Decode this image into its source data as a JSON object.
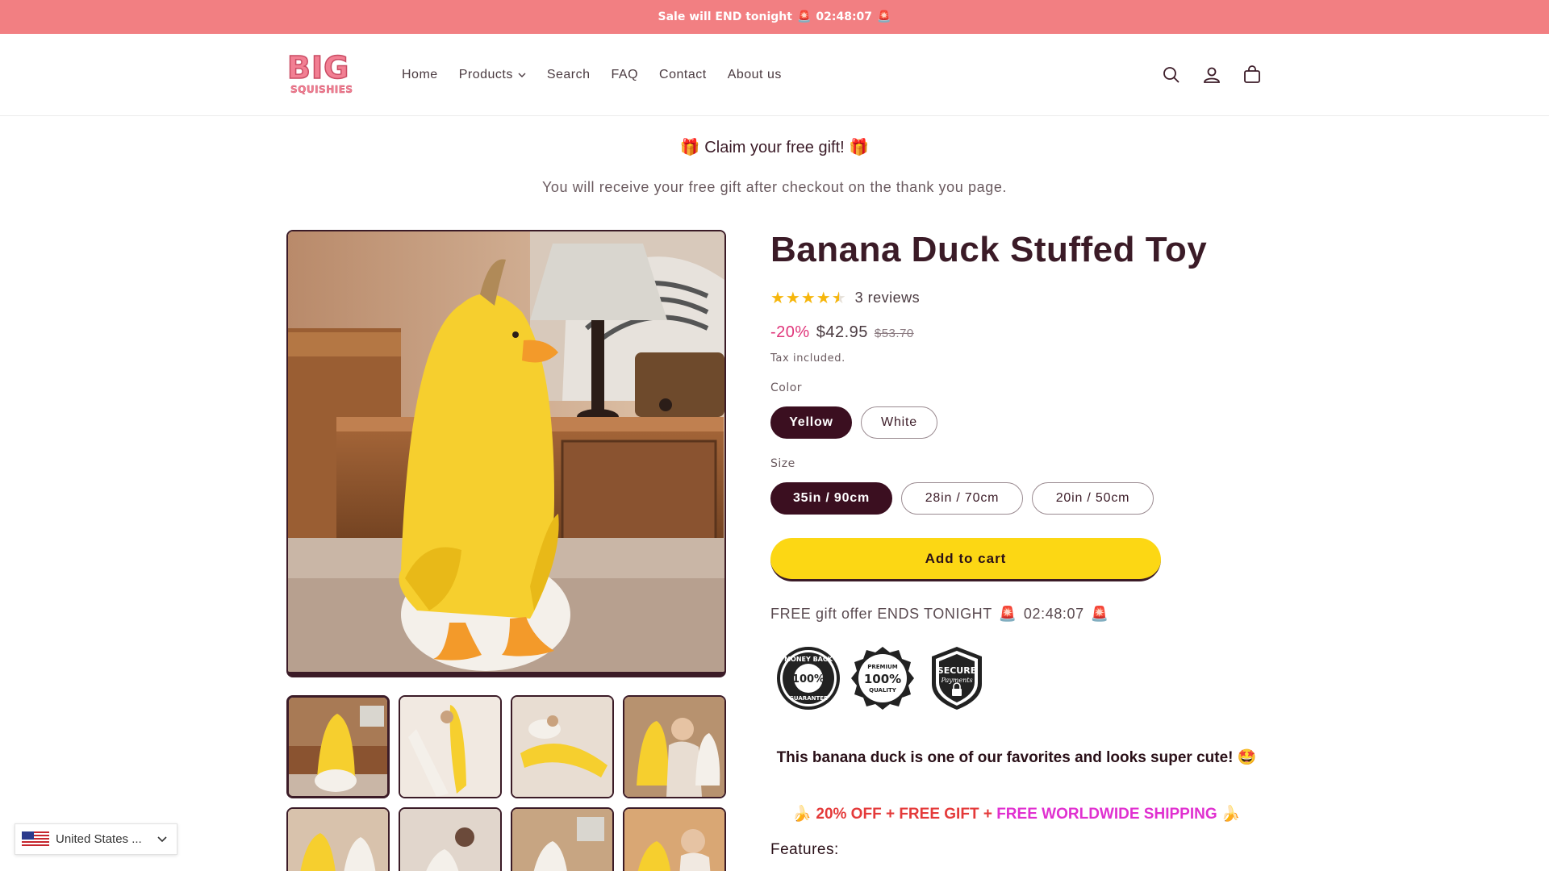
{
  "announcement": {
    "text": "Sale will END tonight",
    "icon": "🚨",
    "timer": "02:48:07"
  },
  "header": {
    "logo": {
      "line1": "BIG",
      "line2": "SQUISHIES"
    },
    "nav": [
      {
        "label": "Home"
      },
      {
        "label": "Products",
        "dropdown": true
      },
      {
        "label": "Search"
      },
      {
        "label": "FAQ"
      },
      {
        "label": "Contact"
      },
      {
        "label": "About us"
      }
    ],
    "icons": [
      "search-icon",
      "account-icon",
      "cart-icon"
    ]
  },
  "promo": {
    "title": "🎁 Claim your free gift! 🎁",
    "subtitle": "You will receive your free gift after checkout on the thank you page."
  },
  "product": {
    "title": "Banana Duck Stuffed Toy",
    "rating": 4.5,
    "reviews_label": "3 reviews",
    "discount": "-20%",
    "price": "$42.95",
    "compare_price": "$53.70",
    "tax_note": "Tax included.",
    "color_label": "Color",
    "colors": [
      "Yellow",
      "White"
    ],
    "selected_color": "Yellow",
    "size_label": "Size",
    "sizes": [
      "35in / 90cm",
      "28in / 70cm",
      "20in / 50cm"
    ],
    "selected_size": "35in / 90cm",
    "add_to_cart": "Add to cart",
    "offer_text": "FREE gift offer ENDS TONIGHT",
    "offer_icon": "🚨",
    "offer_timer": "02:48:07",
    "badges": [
      "MONEY BACK 100% GUARANTEE",
      "PREMIUM 100% QUALITY",
      "SECURE Payments"
    ],
    "desc_line1": "This banana duck is one of our favorites and looks super cute! 🤩",
    "desc_line2_prefix": "🍌",
    "desc_line2_red": "20% OFF + FREE GIFT +",
    "desc_line2_pink": "FREE WORLDWIDE SHIPPING",
    "desc_line2_suffix": "🍌",
    "features_label": "Features:"
  },
  "country_selector": {
    "label": "United States ..."
  },
  "colors": {
    "announcement": "#f27f82",
    "primary": "#3b0f20",
    "button": "#fcd714",
    "discount": "#e0357a",
    "star": "#f6b60c"
  }
}
